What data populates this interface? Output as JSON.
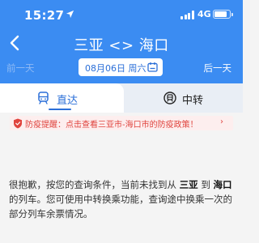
{
  "status_bar": {
    "time": "15:27",
    "network": "4G",
    "battery_level": 0.7
  },
  "header": {
    "title": "三亚 <> 海口",
    "prev_day": "前一天",
    "next_day": "后一天",
    "date": "08月06日 周六"
  },
  "tabs": [
    {
      "label": "直达",
      "active": true
    },
    {
      "label": "中转",
      "active": false
    }
  ],
  "notice": {
    "text": "防疫提醒：点击查看三亚市-海口市的防疫政策！",
    "chevron": "›"
  },
  "message": {
    "part1": "很抱歉，按您的查询条件，当前未找到从",
    "from": "三亚",
    "part2": "到",
    "to": "海口",
    "part3": "的列车。您可使用中转换乘功能，查询途中换乘一次的部分列车余票情况。"
  },
  "colors": {
    "primary": "#3b8cf2",
    "accent_blue": "#2b6fd8",
    "alert_red": "#e0433d"
  },
  "icons": [
    "location-arrow-icon",
    "signal-icon",
    "battery-icon",
    "back-arrow-icon",
    "calendar-icon",
    "train-icon",
    "transfer-train-icon",
    "shield-icon"
  ]
}
